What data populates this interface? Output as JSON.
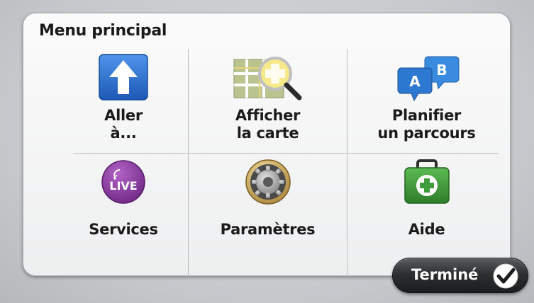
{
  "menu": {
    "title": "Menu principal",
    "items": [
      {
        "label_line1": "Aller",
        "label_line2": "à...",
        "icon": "up-arrow-icon"
      },
      {
        "label_line1": "Afficher",
        "label_line2": "la carte",
        "icon": "map-magnifier-icon"
      },
      {
        "label_line1": "Planifier",
        "label_line2": "un parcours",
        "icon": "ab-route-icon",
        "icon_text_a": "A",
        "icon_text_b": "B"
      },
      {
        "label": "Services",
        "icon": "live-services-icon",
        "icon_text": "LIVE"
      },
      {
        "label": "Paramètres",
        "icon": "gear-settings-icon"
      },
      {
        "label": "Aide",
        "icon": "first-aid-kit-icon"
      }
    ]
  },
  "done": {
    "label": "Terminé",
    "icon": "checkmark-icon"
  },
  "colors": {
    "arrow_blue": "#2a6fd0",
    "live_purple": "#8a3a9e",
    "aid_green": "#3f9c3a",
    "route_blue": "#2d7fd6",
    "button_dark": "#2d2f31"
  }
}
